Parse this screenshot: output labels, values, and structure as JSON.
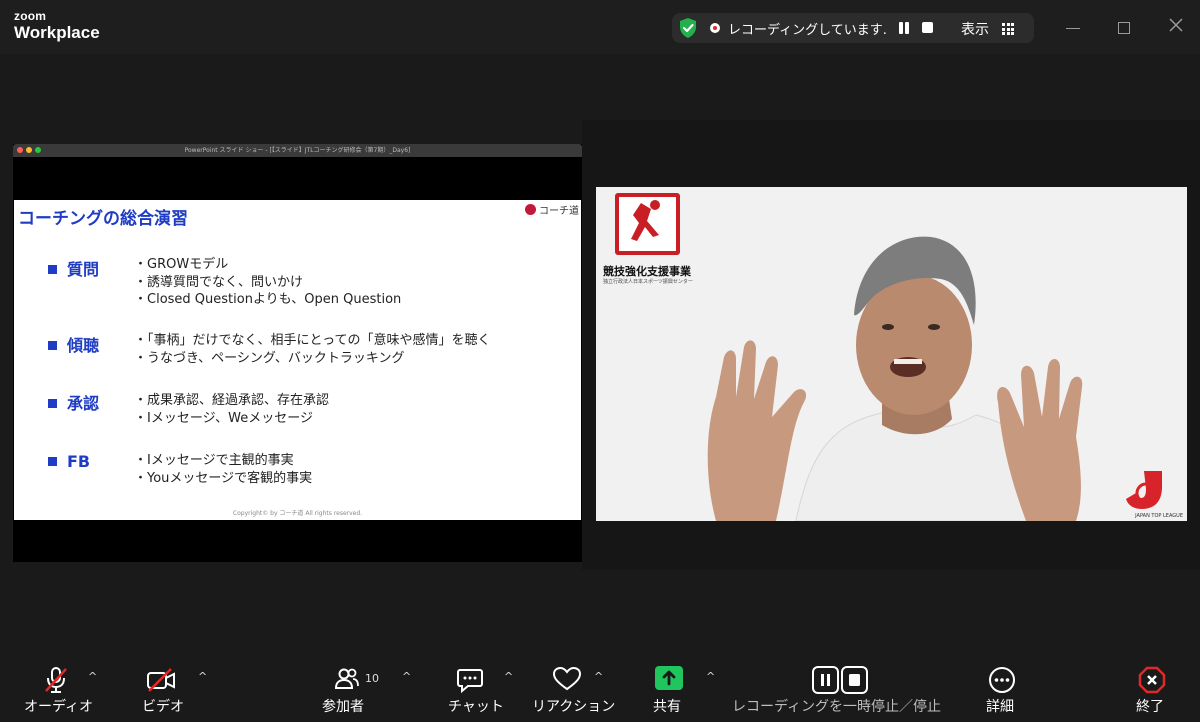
{
  "app": {
    "brand_small": "zoom",
    "brand_large": "Workplace"
  },
  "recording": {
    "status_text": "レコーディングしています...",
    "view_label": "表示"
  },
  "share": {
    "window_title": "PowerPoint スライド ショー - [【スライド】JTLコーチング研修会（第7期）_Day6]",
    "slide": {
      "title": "コーチングの総合演習",
      "logo_text": "コーチ道",
      "sections": [
        {
          "heading": "質問",
          "bullets": [
            "・GROWモデル",
            "・誘導質問でなく、問いかけ",
            "・Closed Questionよりも、Open Question"
          ]
        },
        {
          "heading": "傾聴",
          "bullets": [
            "・「事柄」だけでなく、相手にとっての「意味や感情」を聴く",
            "・うなづき、ペーシング、バックトラッキング"
          ]
        },
        {
          "heading": "承認",
          "bullets": [
            "・成果承認、経過承認、存在承認",
            "・Iメッセージ、Weメッセージ"
          ]
        },
        {
          "heading": "FB",
          "bullets": [
            "・Iメッセージで主観的事実",
            "・Youメッセージで客観的事実"
          ]
        }
      ],
      "copyright": "Copyright© by コーチ道 All rights reserved."
    }
  },
  "video": {
    "logo_title": "競技強化支援事業",
    "logo_sub": "独立行政法人日本スポーツ振興センター",
    "corner_text": "JAPAN TOP LEAGUE"
  },
  "toolbar": {
    "audio": "オーディオ",
    "video": "ビデオ",
    "participants": "参加者",
    "participants_count": "10",
    "chat": "チャット",
    "reactions": "リアクション",
    "share": "共有",
    "recording_control": "レコーディングを一時停止／停止",
    "more": "詳細",
    "end": "終了"
  },
  "colors": {
    "accent_blue": "#1f3cc4",
    "share_green": "#21c55d",
    "end_red": "#e02828",
    "logo_red": "#c81e24"
  }
}
